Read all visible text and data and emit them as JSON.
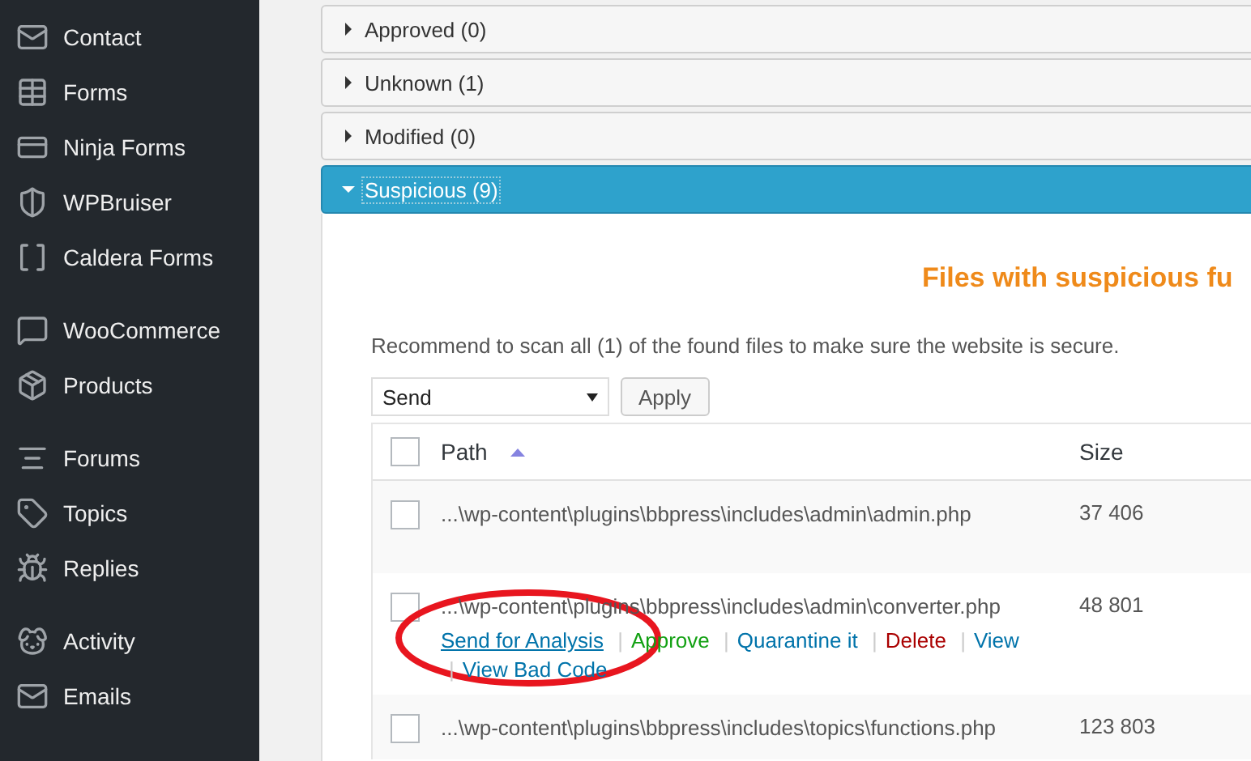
{
  "sidebar": {
    "groups": [
      {
        "items": [
          {
            "label": "Contact"
          },
          {
            "label": "Forms"
          },
          {
            "label": "Ninja Forms"
          },
          {
            "label": "WPBruiser"
          },
          {
            "label": "Caldera Forms"
          }
        ]
      },
      {
        "items": [
          {
            "label": "WooCommerce"
          },
          {
            "label": "Products"
          }
        ]
      },
      {
        "items": [
          {
            "label": "Forums"
          },
          {
            "label": "Topics"
          },
          {
            "label": "Replies"
          }
        ]
      },
      {
        "items": [
          {
            "label": "Activity"
          },
          {
            "label": "Emails"
          }
        ]
      }
    ]
  },
  "sections": [
    {
      "title": "Approved (0)",
      "expanded": false
    },
    {
      "title": "Unknown (1)",
      "expanded": false
    },
    {
      "title": "Modified (0)",
      "expanded": false
    },
    {
      "title": "Suspicious (9)",
      "expanded": true
    }
  ],
  "panel": {
    "heading": "Files with suspicious fu",
    "notice": "Recommend to scan all (1) of the found files to make sure the website is secure.",
    "bulk_action": {
      "value": "Send"
    },
    "apply_button": "Apply",
    "table": {
      "all_checked": false,
      "columns": [
        {
          "label": "Path",
          "sorted": true
        },
        {
          "label": "Size",
          "sorted": false
        }
      ],
      "separator": "|",
      "rows": [
        {
          "path": "...\\wp-content\\plugins\\bbpress\\includes\\admin\\admin.php",
          "size": "37 406",
          "checked": false,
          "actions": []
        },
        {
          "path": "...\\wp-content\\plugins\\bbpress\\includes\\admin\\converter.php",
          "size": "48 801",
          "checked": false,
          "annotated": true,
          "actions": [
            {
              "label": "Send for Analysis",
              "kind": "focus"
            },
            {
              "label": "Approve",
              "kind": "approve"
            },
            {
              "label": "Quarantine it",
              "kind": "link"
            },
            {
              "label": "Delete",
              "kind": "delete"
            },
            {
              "label": "View",
              "kind": "link"
            },
            {
              "label": "View Bad Code",
              "kind": "link"
            }
          ]
        },
        {
          "path": "...\\wp-content\\plugins\\bbpress\\includes\\topics\\functions.php",
          "size": "123 803",
          "checked": false,
          "actions": []
        }
      ]
    }
  }
}
